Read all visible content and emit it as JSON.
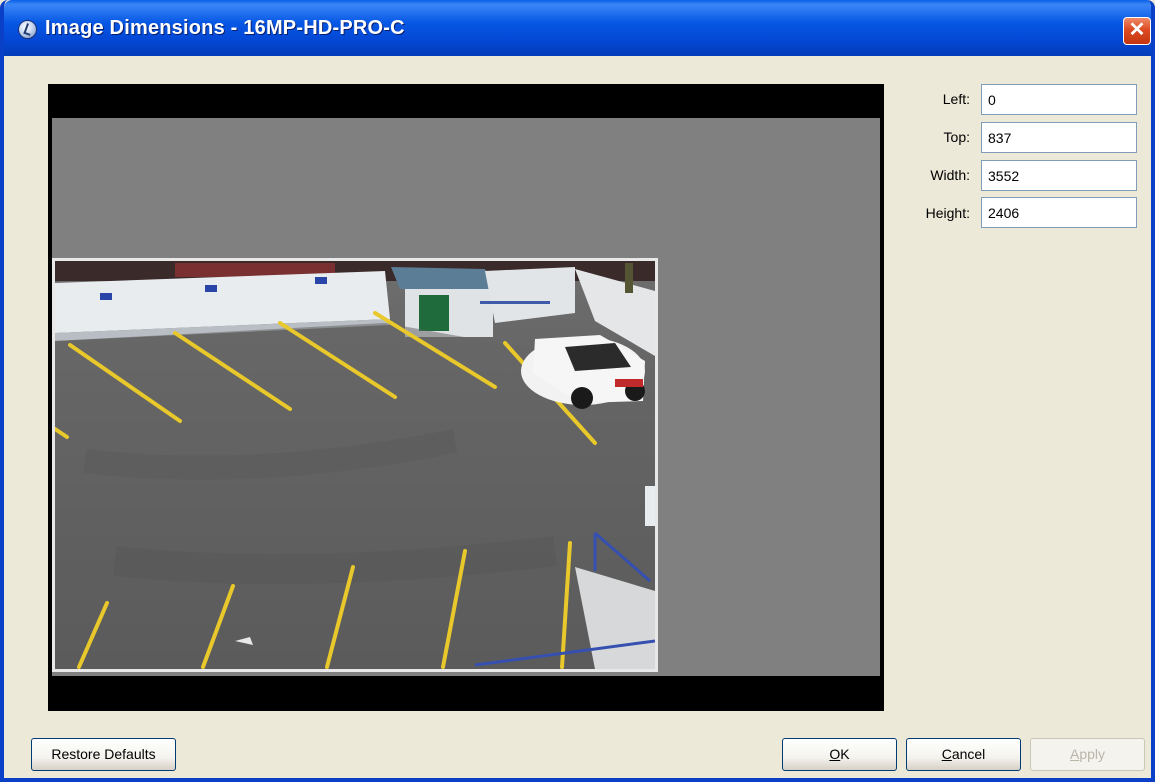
{
  "window": {
    "title": "Image Dimensions - 16MP-HD-PRO-C",
    "close_glyph": "✕",
    "icon": "app-icon"
  },
  "fields": {
    "left": {
      "label": "Left:",
      "value": "0"
    },
    "top": {
      "label": "Top:",
      "value": "837"
    },
    "width": {
      "label": "Width:",
      "value": "3552"
    },
    "height": {
      "label": "Height:",
      "value": "2406"
    }
  },
  "buttons": {
    "restore_defaults": "Restore Defaults",
    "ok_mnemonic": "O",
    "ok_rest": "K",
    "cancel_mnemonic": "C",
    "cancel_rest": "ancel",
    "apply_mnemonic": "A",
    "apply_rest": "pply",
    "apply_enabled": false
  },
  "colors": {
    "title_bar": "#0a5fe8",
    "dialog_bg": "#ece9d8",
    "preview_border": "#000000",
    "preview_bg": "#808080"
  }
}
